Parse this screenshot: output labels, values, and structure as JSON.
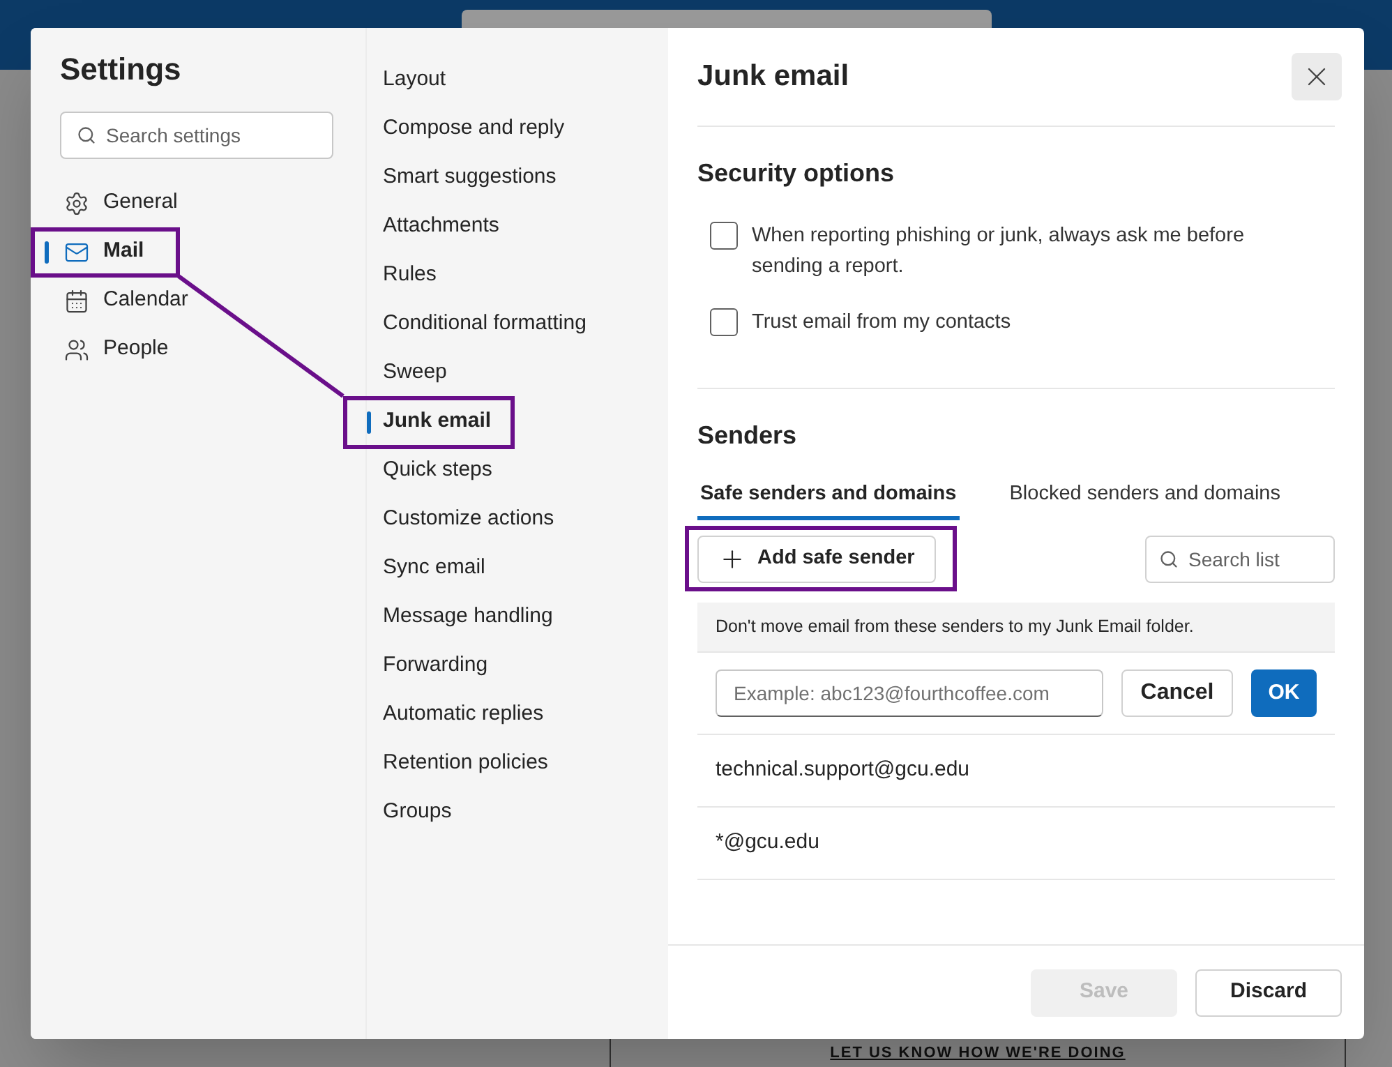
{
  "background": {
    "feedback_link": "LET US KNOW HOW WE'RE DOING"
  },
  "settings": {
    "title": "Settings",
    "search_placeholder": "Search settings",
    "categories": [
      {
        "label": "General",
        "selected": false
      },
      {
        "label": "Mail",
        "selected": true
      },
      {
        "label": "Calendar",
        "selected": false
      },
      {
        "label": "People",
        "selected": false
      }
    ],
    "subcategories": [
      {
        "label": "Layout",
        "selected": false
      },
      {
        "label": "Compose and reply",
        "selected": false
      },
      {
        "label": "Smart suggestions",
        "selected": false
      },
      {
        "label": "Attachments",
        "selected": false
      },
      {
        "label": "Rules",
        "selected": false
      },
      {
        "label": "Conditional formatting",
        "selected": false
      },
      {
        "label": "Sweep",
        "selected": false
      },
      {
        "label": "Junk email",
        "selected": true
      },
      {
        "label": "Quick steps",
        "selected": false
      },
      {
        "label": "Customize actions",
        "selected": false
      },
      {
        "label": "Sync email",
        "selected": false
      },
      {
        "label": "Message handling",
        "selected": false
      },
      {
        "label": "Forwarding",
        "selected": false
      },
      {
        "label": "Automatic replies",
        "selected": false
      },
      {
        "label": "Retention policies",
        "selected": false
      },
      {
        "label": "Groups",
        "selected": false
      }
    ]
  },
  "panel": {
    "title": "Junk email",
    "security": {
      "heading": "Security options",
      "options": [
        {
          "label": "When reporting phishing or junk, always ask me before sending a report.",
          "checked": false
        },
        {
          "label": "Trust email from my contacts",
          "checked": false
        }
      ]
    },
    "senders": {
      "heading": "Senders",
      "tabs": [
        {
          "label": "Safe senders and domains",
          "selected": true
        },
        {
          "label": "Blocked senders and domains",
          "selected": false
        }
      ],
      "add_button": "Add safe sender",
      "search_placeholder": "Search list",
      "info": "Don't move email from these senders to my Junk Email folder.",
      "input_placeholder": "Example: abc123@fourthcoffee.com",
      "cancel": "Cancel",
      "ok": "OK",
      "entries": [
        "technical.support@gcu.edu",
        "*@gcu.edu"
      ]
    },
    "footer": {
      "save": {
        "label": "Save",
        "disabled": true
      },
      "discard": "Discard"
    }
  }
}
